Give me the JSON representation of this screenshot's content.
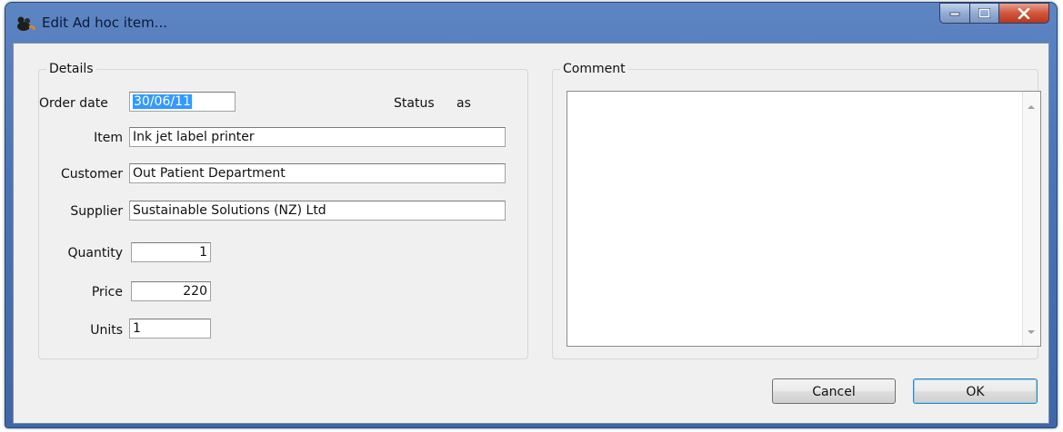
{
  "window": {
    "title": "Edit Ad hoc item...",
    "icon": "mouse-app-icon",
    "controls": {
      "minimize": "minimize-icon",
      "maximize": "maximize-icon",
      "close": "close-icon"
    }
  },
  "details": {
    "group_label": "Details",
    "order_date": {
      "label": "Order date",
      "value": "30/06/11"
    },
    "status": {
      "label": "Status",
      "value": "as"
    },
    "item": {
      "label": "Item",
      "value": "Ink jet label printer"
    },
    "customer": {
      "label": "Customer",
      "value": "Out Patient Department"
    },
    "supplier": {
      "label": "Supplier",
      "value": "Sustainable Solutions (NZ) Ltd"
    },
    "quantity": {
      "label": "Quantity",
      "value": "1"
    },
    "price": {
      "label": "Price",
      "value": "220"
    },
    "units": {
      "label": "Units",
      "value": "1"
    }
  },
  "comment": {
    "group_label": "Comment",
    "value": ""
  },
  "buttons": {
    "cancel": "Cancel",
    "ok": "OK"
  },
  "colors": {
    "title_bar": "#4a74b6",
    "selection": "#3399ff",
    "close_button": "#d2553c"
  }
}
